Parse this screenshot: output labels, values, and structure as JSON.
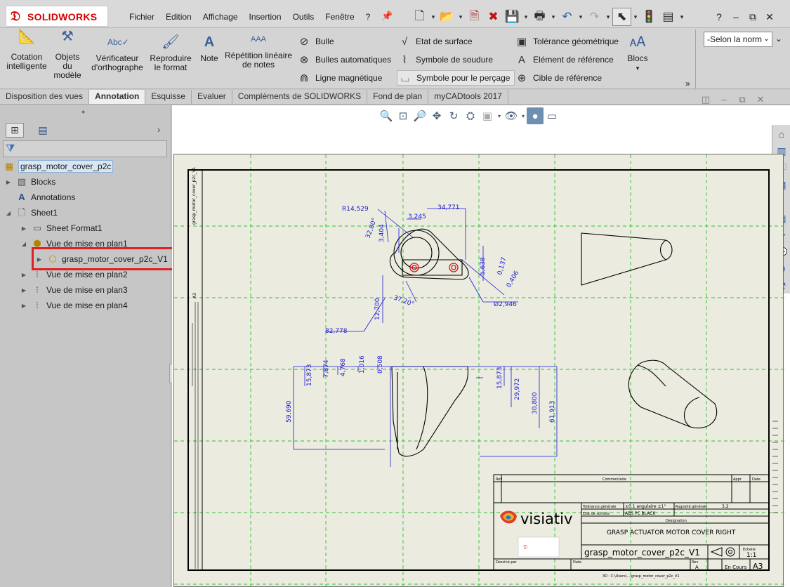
{
  "app": {
    "logo_text": "SOLIDWORKS",
    "menu": [
      "Fichier",
      "Edition",
      "Affichage",
      "Insertion",
      "Outils",
      "Fenêtre",
      "?"
    ]
  },
  "ribbon": {
    "big_buttons": [
      {
        "label_1": "Cotation",
        "label_2": "intelligente",
        "icon": "smart-dimension-icon"
      },
      {
        "label_1": "Objets",
        "label_2": "du",
        "label_3": "modèle",
        "icon": "model-items-icon"
      },
      {
        "label_1": "Vérificateur",
        "label_2": "d'orthographe",
        "icon": "spell-checker-icon"
      },
      {
        "label_1": "Reproduire",
        "label_2": "le format",
        "icon": "format-painter-icon"
      },
      {
        "label_1": "Note",
        "icon": "note-icon"
      },
      {
        "label_1": "Répétition linéaire",
        "label_2": "de notes",
        "icon": "linear-note-pattern-icon"
      }
    ],
    "col1": [
      "Bulle",
      "Bulles automatiques",
      "Ligne magnétique"
    ],
    "col2": [
      "Etat de surface",
      "Symbole de soudure",
      "Symbole pour le perçage"
    ],
    "col3": [
      "Tolérance géométrique",
      "Elément de référence",
      "Cible de référence"
    ],
    "blocks": "Blocs",
    "style_select": "-Selon la norm"
  },
  "tabs": [
    "Disposition des vues",
    "Annotation",
    "Esquisse",
    "Evaluer",
    "Compléments de SOLIDWORKS",
    "Fond de plan",
    "myCADtools 2017"
  ],
  "active_tab": "Annotation",
  "tree": {
    "root": "grasp_motor_cover_p2c",
    "blocks": "Blocks",
    "annotations": "Annotations",
    "sheet": "Sheet1",
    "sheet_format": "Sheet Format1",
    "view1": "Vue de mise en plan1",
    "component": "grasp_motor_cover_p2c_V1",
    "view2": "Vue de mise en plan2",
    "view3": "Vue de mise en plan3",
    "view4": "Vue de mise en plan4"
  },
  "drawing": {
    "dims_top": [
      "R14,529",
      "34,771",
      "3,245",
      "32,80°",
      "3,404",
      "5,638",
      "0,137",
      "0,406",
      "Ø2,946",
      "37,20°",
      "12,700",
      "82,778"
    ],
    "dims_front": [
      "15,873",
      "7,874",
      "4,768",
      "1,016",
      "0,508",
      "15,873",
      "29,972",
      "30,800",
      "61,913",
      "59,690"
    ],
    "side_label": "grasp_motor_cover_p2c_V1",
    "title_block": {
      "title": "GRASP ACTUATOR MOTOR COVER RIGHT",
      "part_name": "grasp_motor_cover_p2c_V1",
      "company": "visiativ",
      "scale_label": "Echelle",
      "scale": "1:1",
      "format": "A3",
      "revision_label": "Commentaire",
      "status": "En Cours",
      "rev": "A",
      "designation_label": "Designation",
      "tol_label": "Tolérance générale",
      "tol_value": "±0.1 angulaire ±1°",
      "state_label": "Etat de surface",
      "state_value": "ABS PC BLACK",
      "surface_label": "Rugosité générale",
      "surface_value": "3.2",
      "path": "3D : C:\\Users\\...\\grasp_motor_cover_p2c_V1",
      "code_label": "Dessiné par",
      "date_label": "Date",
      "rev_label": "Rev",
      "col_rev": "Rev",
      "col_appr": "Appr",
      "col_date": "Date"
    }
  }
}
